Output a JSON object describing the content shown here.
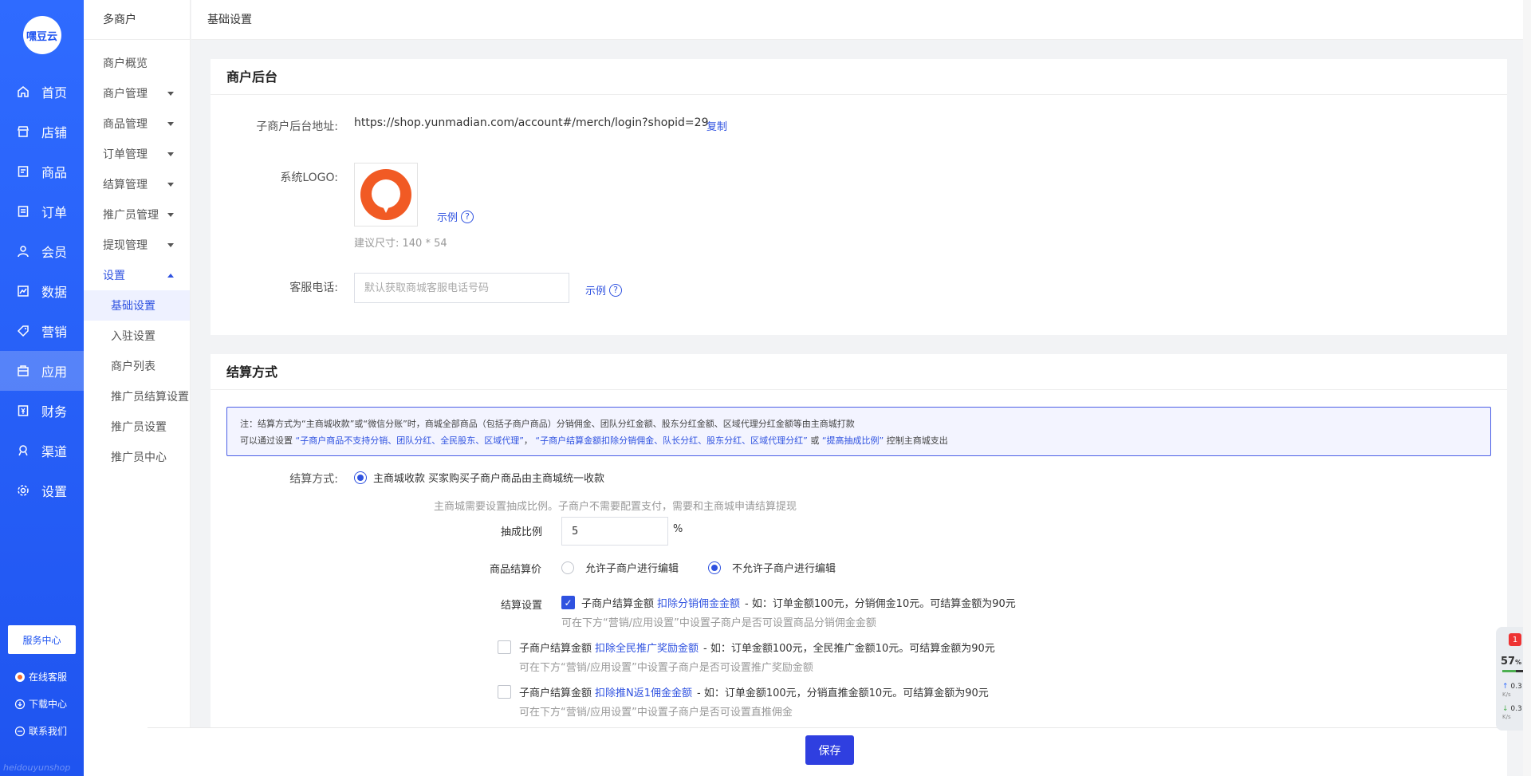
{
  "brand": {
    "logo_text": "嘿豆云",
    "watermark": "heidouyunshop"
  },
  "mainnav": [
    {
      "label": "首页",
      "icon": "home-icon"
    },
    {
      "label": "店铺",
      "icon": "store-icon"
    },
    {
      "label": "商品",
      "icon": "goods-icon"
    },
    {
      "label": "订单",
      "icon": "order-icon"
    },
    {
      "label": "会员",
      "icon": "user-icon"
    },
    {
      "label": "数据",
      "icon": "chart-icon"
    },
    {
      "label": "营销",
      "icon": "tag-icon"
    },
    {
      "label": "应用",
      "icon": "app-icon"
    },
    {
      "label": "财务",
      "icon": "finance-icon"
    },
    {
      "label": "渠道",
      "icon": "channel-icon"
    },
    {
      "label": "设置",
      "icon": "gear-icon"
    }
  ],
  "service_center": "服务中心",
  "footer_links": {
    "online": "在线客服",
    "download": "下载中心",
    "contact": "联系我们"
  },
  "subnav": {
    "header": "多商户",
    "items": [
      "商户概览",
      "商户管理",
      "商品管理",
      "订单管理",
      "结算管理",
      "推广员管理",
      "提现管理",
      "设置"
    ],
    "settings_children": [
      "基础设置",
      "入驻设置",
      "商户列表",
      "推广员结算设置",
      "推广员设置",
      "推广员中心"
    ]
  },
  "topbar": {
    "title": "基础设置"
  },
  "merchant_backend": {
    "title": "商户后台",
    "url_label": "子商户后台地址:",
    "url": "https://shop.yunmadian.com/account#/merch/login?shopid=29",
    "copy": "复制",
    "logo_label": "系统LOGO:",
    "example": "示例",
    "size_hint": "建议尺寸: 140 * 54",
    "phone_label": "客服电话:",
    "phone_placeholder": "默认获取商城客服电话号码"
  },
  "settlement": {
    "title": "结算方式",
    "notice_line1": "注：结算方式为“主商城收款”或“微信分账”时，商城全部商品（包括子商户商品）分销佣金、团队分红金额、股东分红金额、区域代理分红金额等由主商城打款",
    "notice_line2_a": "可以通过设置",
    "notice_line2_b": "“子商户商品不支持分销、团队分红、全民股东、区域代理”",
    "notice_line2_c": "，",
    "notice_line2_d": "“子商户结算金额扣除分销佣金、队长分红、股东分红、区域代理分红”",
    "notice_line2_e": "或",
    "notice_line2_f": "“提高抽成比例”",
    "notice_line2_g": "控制主商城支出",
    "mode_label": "结算方式:",
    "mode_option": "主商城收款",
    "mode_desc": "买家购买子商户商品由主商城统一收款",
    "mode_hint": "主商城需要设置抽成比例。子商户不需要配置支付，需要和主商城申请结算提现",
    "ratio_label": "抽成比例",
    "ratio_value": "5",
    "ratio_unit": "%",
    "price_label": "商品结算价",
    "price_opt1": "允许子商户进行编辑",
    "price_opt2": "不允许子商户进行编辑",
    "setting_label": "结算设置",
    "rules": [
      {
        "checked": true,
        "pre": "子商户结算金额",
        "link": "扣除分销佣金金额",
        "post": "- 如：订单金额100元，分销佣金10元。可结算金额为90元",
        "hint": "可在下方“营销/应用设置”中设置子商户是否可设置商品分销佣金金额"
      },
      {
        "checked": false,
        "pre": "子商户结算金额",
        "link": "扣除全民推广奖励金额",
        "post": "- 如：订单金额100元，全民推广金额10元。可结算金额为90元",
        "hint": "可在下方“营销/应用设置”中设置子商户是否可设置推广奖励金额"
      },
      {
        "checked": false,
        "pre": "子商户结算金额",
        "link": "扣除推N返1佣金金额",
        "post": "- 如：订单金额100元，分销直推金额10元。可结算金额为90元",
        "hint": "可在下方“营销/应用设置”中设置子商户是否可设置直推佣金"
      }
    ]
  },
  "save": "保存",
  "widget": {
    "badge": "1",
    "percent": "57",
    "unit": "%",
    "up": "0.3",
    "down": "0.3",
    "rate_unit": "K/s"
  }
}
